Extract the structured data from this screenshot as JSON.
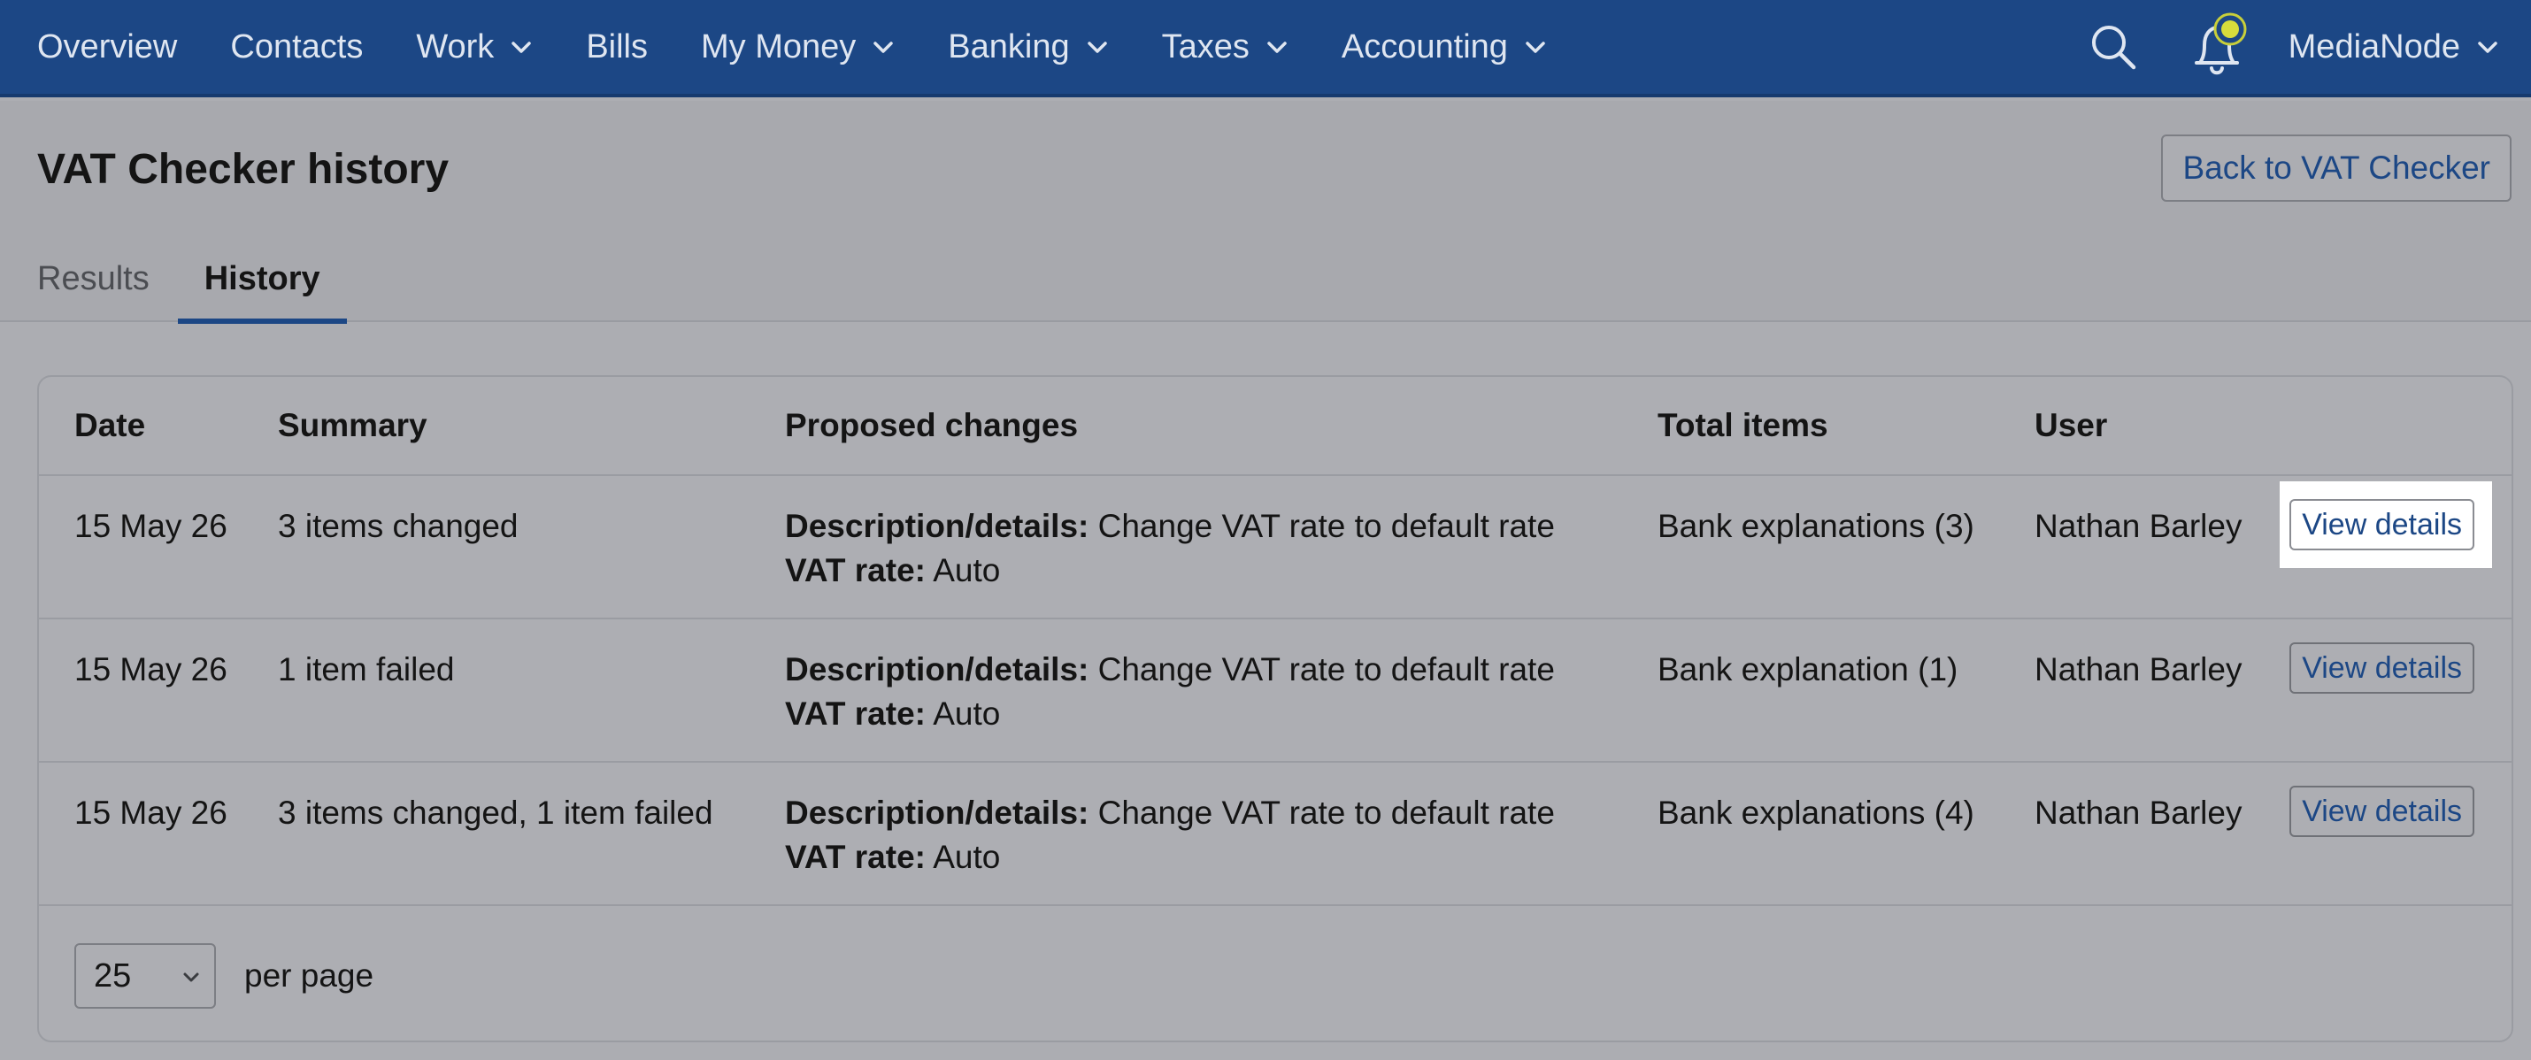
{
  "nav": {
    "items": [
      {
        "label": "Overview",
        "dropdown": false
      },
      {
        "label": "Contacts",
        "dropdown": false
      },
      {
        "label": "Work",
        "dropdown": true
      },
      {
        "label": "Bills",
        "dropdown": false
      },
      {
        "label": "My Money",
        "dropdown": true
      },
      {
        "label": "Banking",
        "dropdown": true
      },
      {
        "label": "Taxes",
        "dropdown": true
      },
      {
        "label": "Accounting",
        "dropdown": true
      }
    ],
    "account_label": "MediaNode",
    "icons": [
      "search-icon",
      "bell-icon",
      "chevron-down-icon"
    ],
    "bell_indicator_color": "#d7dd3b"
  },
  "page": {
    "title": "VAT Checker history",
    "back_button": "Back to VAT Checker",
    "tabs": [
      {
        "label": "Results",
        "active": false
      },
      {
        "label": "History",
        "active": true
      }
    ]
  },
  "table": {
    "headers": [
      "Date",
      "Summary",
      "Proposed changes",
      "Total items",
      "User"
    ],
    "rows": [
      {
        "date": "15 May 26",
        "summary": "3 items changed",
        "change_label_1": "Description/details:",
        "change_value_1": " Change VAT rate to default rate",
        "change_label_2": "VAT rate:",
        "change_value_2": " Auto",
        "total": "Bank explanations (3)",
        "user": "Nathan Barley",
        "action": "View details",
        "highlighted": true
      },
      {
        "date": "15 May 26",
        "summary": "1 item failed",
        "change_label_1": "Description/details:",
        "change_value_1": " Change VAT rate to default rate",
        "change_label_2": "VAT rate:",
        "change_value_2": " Auto",
        "total": "Bank explanation (1)",
        "user": "Nathan Barley",
        "action": "View details",
        "highlighted": false
      },
      {
        "date": "15 May 26",
        "summary": "3 items changed, 1 item failed",
        "change_label_1": "Description/details:",
        "change_value_1": " Change VAT rate to default rate",
        "change_label_2": "VAT rate:",
        "change_value_2": " Auto",
        "total": "Bank explanations (4)",
        "user": "Nathan Barley",
        "action": "View details",
        "highlighted": false
      }
    ]
  },
  "pagination": {
    "per_page_value": "25",
    "per_page_label": "per page"
  },
  "colors": {
    "nav_bg": "#1c4785",
    "link": "#1c4785",
    "page_bg": "#acadb2"
  }
}
